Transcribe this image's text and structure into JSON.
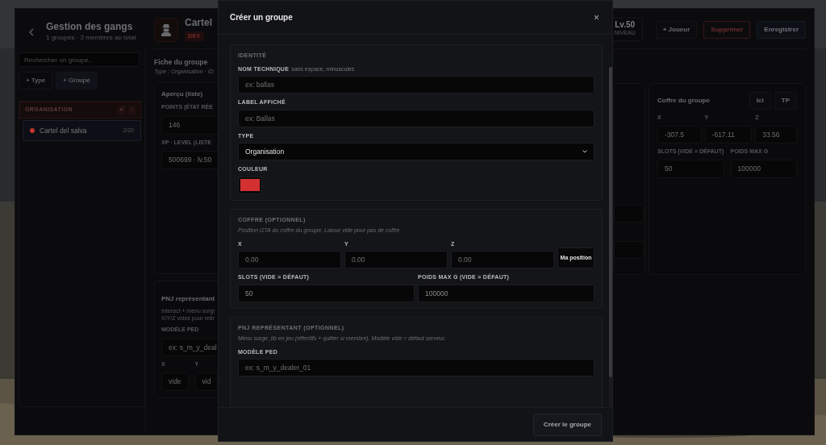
{
  "app": {
    "title": "Gestion des gangs",
    "subtitle": "1 groupes · 2 membres au total"
  },
  "sidebar": {
    "search": {
      "placeholder": "Rechercher un groupe..."
    },
    "buttons": [
      {
        "label": "+ Type",
        "selected": false
      },
      {
        "label": "+ Groupe",
        "selected": true
      }
    ],
    "sections": [
      {
        "label": "ORGANISATION",
        "actions": [
          "×",
          "↑"
        ],
        "groups": [
          {
            "name": "Cartel del salva",
            "count": "2/20",
            "color": "#c0392b",
            "selected": true
          }
        ]
      }
    ]
  },
  "group": {
    "name": "Cartel",
    "badge": "DEV",
    "stats": [
      {
        "value": "Lv.50",
        "label": "NIVEAU"
      }
    ],
    "buttons": [
      {
        "label": "+ Joueur",
        "kind": "default"
      },
      {
        "label": "Supprimer",
        "kind": "danger"
      },
      {
        "label": "Enregistrer",
        "kind": "primary"
      }
    ]
  },
  "sheet": {
    "title": "Fiche du groupe",
    "meta": "Type : Organisation · ID"
  },
  "overview": {
    "title": "Aperçu (liste)",
    "fields": [
      {
        "label": "POINTS (ÉTAT RÉE",
        "value": "146"
      },
      {
        "label": "XP · LEVEL (LISTE",
        "value": "500699 · lv.50"
      }
    ]
  },
  "npc_card": {
    "title": "PNJ représentant",
    "note": [
      "Interact + menu surgi",
      "X/Y/Z vides pour retir"
    ],
    "model": {
      "label": "MODÈLE PED",
      "placeholder": "ex: s_m_y_deal"
    },
    "coords": [
      {
        "label": "X",
        "placeholder": "vide"
      },
      {
        "label": "Y",
        "placeholder": "vid"
      }
    ]
  },
  "chest_card": {
    "title": "Coffre du groupe",
    "buttons": [
      "Ici",
      "TP"
    ],
    "coords": [
      {
        "label": "X",
        "value": "-307.5"
      },
      {
        "label": "Y",
        "value": "-617.11"
      },
      {
        "label": "Z",
        "value": "33.56"
      }
    ],
    "fields": [
      {
        "label": "SLOTS (VIDE = DÉFAUT)",
        "value": "50"
      },
      {
        "label": "POIDS MAX G",
        "value": "100000"
      }
    ]
  },
  "modal": {
    "title": "Créer un groupe",
    "close": "×",
    "identity": {
      "title": "IDENTITÉ",
      "name": {
        "label": "NOM TECHNIQUE",
        "hint": "sans espace, minuscules",
        "placeholder": "ex: ballas"
      },
      "display": {
        "label": "LABEL AFFICHÉ",
        "placeholder": "ex: Ballas"
      },
      "type": {
        "label": "TYPE",
        "value": "Organisation"
      },
      "color": {
        "label": "COULEUR",
        "color": "#d33131"
      }
    },
    "chest": {
      "title": "COFFRE (OPTIONNEL)",
      "note": "Position GTA du coffre du groupe. Laisse vide pour pas de coffre.",
      "coords": [
        {
          "label": "X",
          "placeholder": "0.00"
        },
        {
          "label": "Y",
          "placeholder": "0.00"
        },
        {
          "label": "Z",
          "placeholder": "0.00"
        }
      ],
      "position_button": "Ma position",
      "fields": [
        {
          "label": "SLOTS (VIDE = DÉFAUT)",
          "value": "50"
        },
        {
          "label": "POIDS MAX G (VIDE = DÉFAUT)",
          "value": "100000"
        }
      ]
    },
    "npc": {
      "title": "PNJ REPRÉSENTANT (OPTIONNEL)",
      "note": "Menu surge_lib en jeu (effectifs + quitter si membre). Modèle vide = défaut serveur.",
      "model": {
        "label": "MODÈLE PED",
        "placeholder": "ex: s_m_y_dealer_01"
      }
    },
    "submit": "Créer le groupe"
  }
}
